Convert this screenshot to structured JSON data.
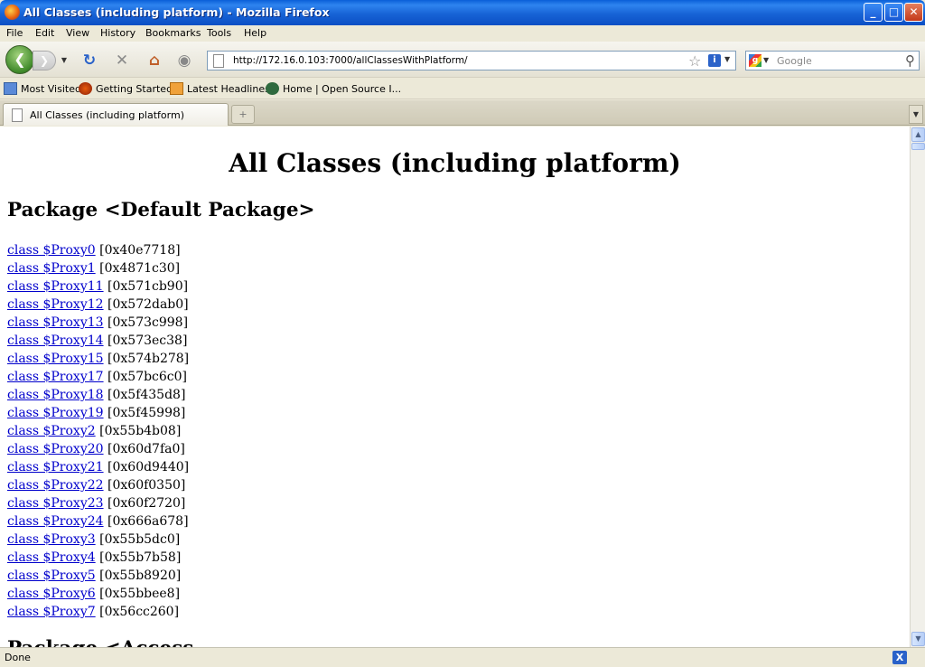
{
  "window": {
    "title": "All Classes (including platform) - Mozilla Firefox",
    "buttons": {
      "minimize": "_",
      "maximize": "□",
      "close": "✕"
    }
  },
  "menu": [
    "File",
    "Edit",
    "View",
    "History",
    "Bookmarks",
    "Tools",
    "Help"
  ],
  "nav": {
    "url": "http://172.16.0.103:7000/allClassesWithPlatform/",
    "search_placeholder": "Google"
  },
  "bookmarks": [
    "Most Visited",
    "Getting Started",
    "Latest Headlines",
    "Home | Open Source I..."
  ],
  "tabs": {
    "active_label": "All Classes (including platform)",
    "new_tab_symbol": "+"
  },
  "page": {
    "heading": "All Classes (including platform)",
    "package_heading": "Package <Default Package>",
    "classes": [
      {
        "name": "class $Proxy0",
        "addr": "[0x40e7718]"
      },
      {
        "name": "class $Proxy1",
        "addr": "[0x4871c30]"
      },
      {
        "name": "class $Proxy11",
        "addr": "[0x571cb90]"
      },
      {
        "name": "class $Proxy12",
        "addr": "[0x572dab0]"
      },
      {
        "name": "class $Proxy13",
        "addr": "[0x573c998]"
      },
      {
        "name": "class $Proxy14",
        "addr": "[0x573ec38]"
      },
      {
        "name": "class $Proxy15",
        "addr": "[0x574b278]"
      },
      {
        "name": "class $Proxy17",
        "addr": "[0x57bc6c0]"
      },
      {
        "name": "class $Proxy18",
        "addr": "[0x5f435d8]"
      },
      {
        "name": "class $Proxy19",
        "addr": "[0x5f45998]"
      },
      {
        "name": "class $Proxy2",
        "addr": "[0x55b4b08]"
      },
      {
        "name": "class $Proxy20",
        "addr": "[0x60d7fa0]"
      },
      {
        "name": "class $Proxy21",
        "addr": "[0x60d9440]"
      },
      {
        "name": "class $Proxy22",
        "addr": "[0x60f0350]"
      },
      {
        "name": "class $Proxy23",
        "addr": "[0x60f2720]"
      },
      {
        "name": "class $Proxy24",
        "addr": "[0x666a678]"
      },
      {
        "name": "class $Proxy3",
        "addr": "[0x55b5dc0]"
      },
      {
        "name": "class $Proxy4",
        "addr": "[0x55b7b58]"
      },
      {
        "name": "class $Proxy5",
        "addr": "[0x55b8920]"
      },
      {
        "name": "class $Proxy6",
        "addr": "[0x55bbee8]"
      },
      {
        "name": "class $Proxy7",
        "addr": "[0x56cc260]"
      }
    ],
    "next_heading_partial": "Package <Access..."
  },
  "status": {
    "text": "Done"
  },
  "colors": {
    "link": "#0000cc",
    "titlebar": "#0b4fc4"
  }
}
